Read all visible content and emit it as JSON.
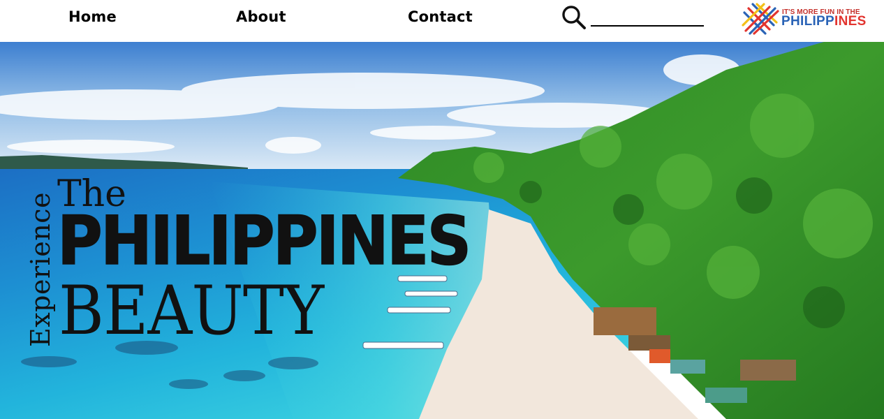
{
  "nav": {
    "home": "Home",
    "about": "About",
    "contact": "Contact"
  },
  "search": {
    "icon": "search-icon",
    "value": "",
    "placeholder": ""
  },
  "logo": {
    "line1": "IT'S MORE FUN IN THE",
    "line2a": "PHILIPP",
    "line2b": "INES",
    "colors": {
      "blue": "#2a63b6",
      "red": "#e2342f",
      "yellow": "#f3c018"
    }
  },
  "hero": {
    "experience": "Experience",
    "the": "The",
    "country": "PHILIPPINES",
    "beauty": "BEAUTY",
    "text_color": "#111111"
  }
}
